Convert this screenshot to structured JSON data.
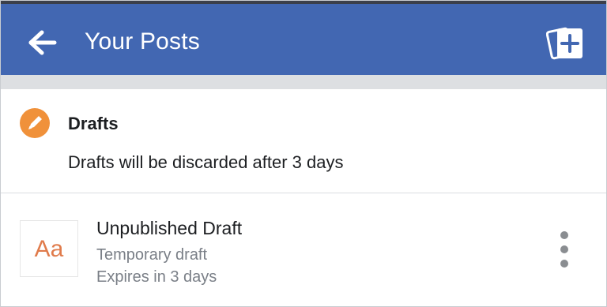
{
  "header": {
    "title": "Your Posts",
    "back_icon": "arrow-left-icon",
    "new_post_icon": "new-post-plus-icon",
    "bar_color": "#4267b2"
  },
  "drafts": {
    "icon": "pencil-icon",
    "icon_color": "#f0913a",
    "title": "Drafts",
    "note": "Drafts will be discarded after 3 days"
  },
  "draft_item": {
    "thumb_text": "Aa",
    "thumb_color": "#e07b4b",
    "title": "Unpublished Draft",
    "subtitle": "Temporary draft",
    "expiry": "Expires in 3 days",
    "menu_icon": "more-vertical-icon"
  }
}
